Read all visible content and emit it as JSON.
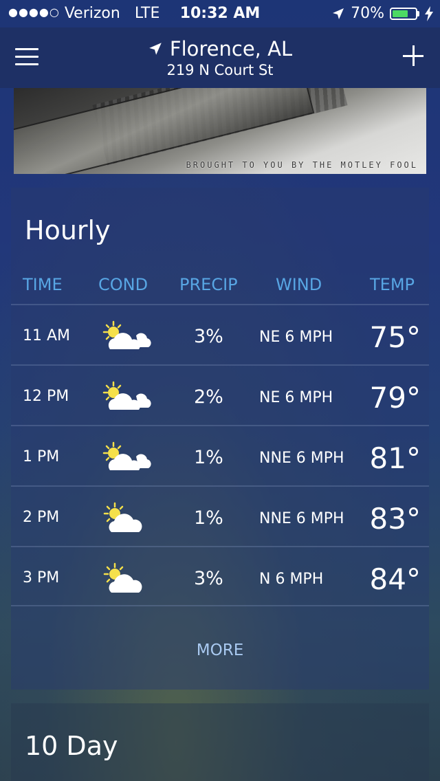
{
  "status_bar": {
    "signal_dots": "●●●●○",
    "carrier": "Verizon",
    "network": "LTE",
    "time": "10:32 AM",
    "battery_percent": "70%",
    "battery_level": 0.7
  },
  "header": {
    "city": "Florence, AL",
    "address": "219 N Court St"
  },
  "ad": {
    "credit": "BROUGHT TO YOU BY THE MOTLEY FOOL"
  },
  "hourly": {
    "title": "Hourly",
    "columns": [
      "TIME",
      "COND",
      "PRECIP",
      "WIND",
      "TEMP"
    ],
    "rows": [
      {
        "time": "11 AM",
        "cond": "partly-cloudy",
        "precip": "3%",
        "wind": "NE 6 MPH",
        "temp": "75°"
      },
      {
        "time": "12 PM",
        "cond": "partly-cloudy",
        "precip": "2%",
        "wind": "NE 6 MPH",
        "temp": "79°"
      },
      {
        "time": "1 PM",
        "cond": "partly-cloudy",
        "precip": "1%",
        "wind": "NNE 6 MPH",
        "temp": "81°"
      },
      {
        "time": "2 PM",
        "cond": "mostly-sunny",
        "precip": "1%",
        "wind": "NNE 6 MPH",
        "temp": "83°"
      },
      {
        "time": "3 PM",
        "cond": "mostly-sunny",
        "precip": "3%",
        "wind": "N 6 MPH",
        "temp": "84°"
      }
    ],
    "more_label": "MORE"
  },
  "ten_day": {
    "title": "10 Day"
  },
  "colors": {
    "accent_header": "#58a6e4",
    "battery_green": "#4cd964",
    "sun_yellow": "#f5e04a"
  }
}
